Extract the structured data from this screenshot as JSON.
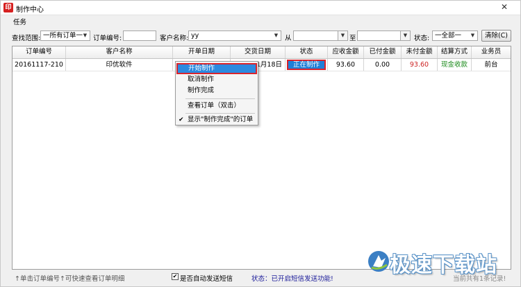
{
  "window": {
    "title": "制作中心",
    "app_icon": "印",
    "close_glyph": "✕"
  },
  "menu": {
    "task": "任务"
  },
  "filter": {
    "scope_label": "查找范围:",
    "scope_value": "一所有订单一",
    "order_no_label": "订单编号:",
    "order_no_value": "",
    "customer_label": "客户名称:",
    "customer_value": "yy",
    "from_label": "从",
    "from_value": "",
    "to_label": "至",
    "to_value": "",
    "status_label": "状态:",
    "status_value": "一全部一",
    "clear_button": "清除(C)"
  },
  "table": {
    "headers": [
      "订单编号",
      "客户名称",
      "开单日期",
      "交货日期",
      "状态",
      "应收金额",
      "已付金额",
      "未付金额",
      "结算方式",
      "业务员"
    ],
    "rows": [
      {
        "order_no": "20161117-210",
        "customer": "印优软件",
        "open_date": "",
        "delivery_date": "1月18日",
        "status": "正在制作",
        "receivable": "93.60",
        "paid": "0.00",
        "unpaid": "93.60",
        "settlement": "现金收款",
        "salesperson": "前台"
      }
    ]
  },
  "context_menu": {
    "start": "开始制作",
    "cancel": "取消制作",
    "complete": "制作完成",
    "view_order": "查看订单（双击）",
    "show_completed": "显示\"制作完成\"的订单",
    "check_glyph": "✔"
  },
  "statusbar": {
    "hint": "↑单击订单编号↑可快速查看订单明细",
    "auto_sms_label": "是否自动发送短信",
    "auto_sms_checked": "✔",
    "sms_status": "状态：已开启短信发送功能!",
    "record_count": "当前共有1条记录!"
  },
  "watermark": {
    "text": "极速下载站"
  },
  "colors": {
    "accent_blue": "#1e7fd8",
    "highlight_red": "#d9232b",
    "unpaid_red": "#cc2222",
    "settle_green": "#1a8a1a"
  }
}
